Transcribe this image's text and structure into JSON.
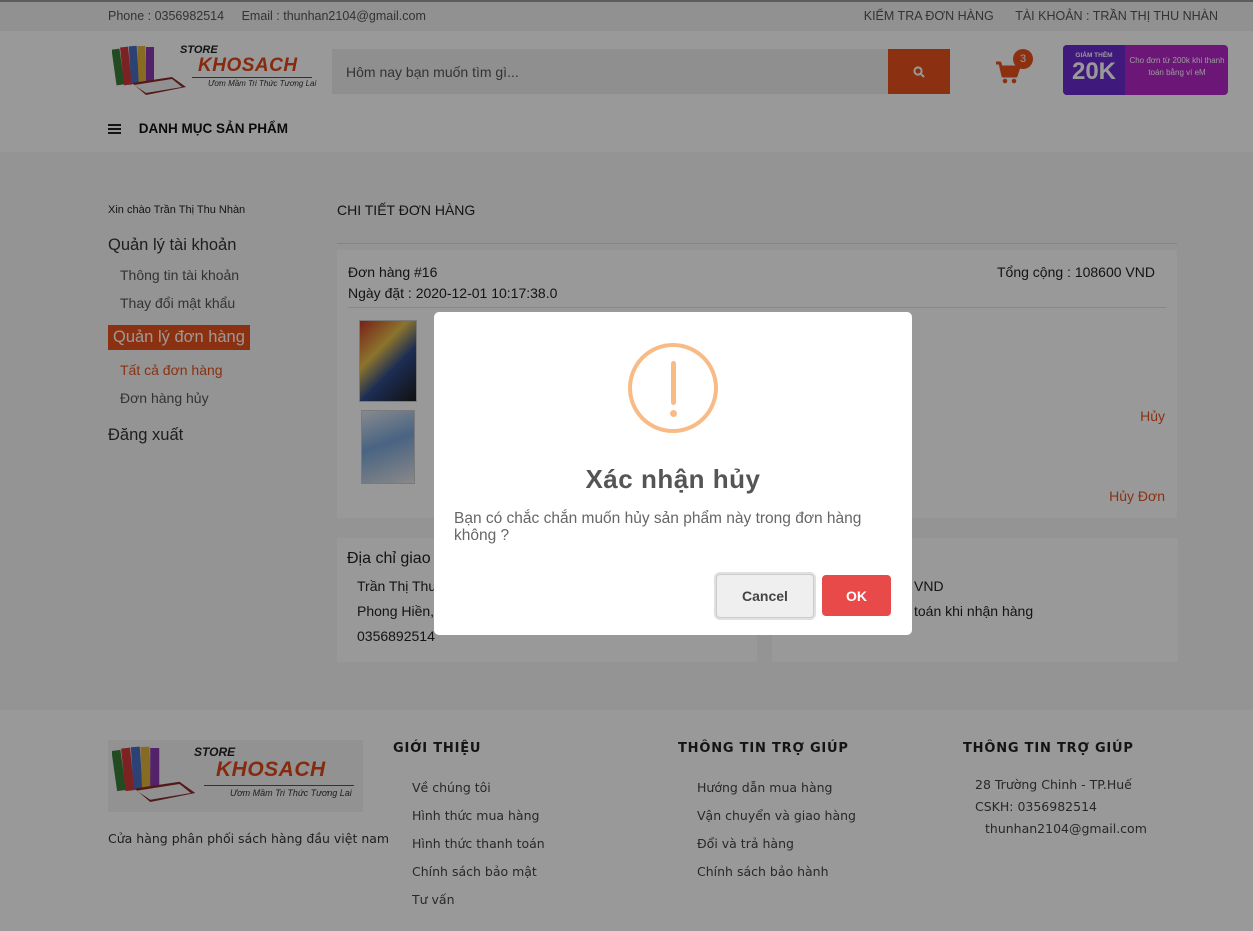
{
  "topbar": {
    "phone": "Phone : 0356982514",
    "email": "Email : thunhan2104@gmail.com",
    "check_order": "KIỂM TRA ĐƠN HÀNG",
    "account": "TÀI KHOẢN : TRẦN THỊ THU NHÀN"
  },
  "logo": {
    "store": "STORE",
    "brand": "KHOSACH",
    "slogan": "Ươm Mầm Tri Thức Tương Lai"
  },
  "search": {
    "placeholder": "Hôm nay bạn muốn tìm gì...",
    "icon": "search-icon"
  },
  "cart": {
    "icon": "cart-icon",
    "count": "3"
  },
  "promo": {
    "small": "GIẢM THÊM",
    "big": "20K",
    "text": "Cho đơn từ 200k khi thanh toán bằng ví eM"
  },
  "category_menu": {
    "label": "DANH MỤC SẢN PHẨM",
    "icon": "menu-icon"
  },
  "sidebar": {
    "greeting": "Xin chào Trần Thị Thu Nhàn",
    "account_section": "Quản lý tài khoản",
    "account_info": "Thông tin tài khoản",
    "change_password": "Thay đổi mật khẩu",
    "orders_section": "Quản lý đơn hàng",
    "all_orders": "Tất cả đơn hàng",
    "cancelled_orders": "Đơn hàng hủy",
    "logout": "Đăng xuất"
  },
  "content": {
    "title": "CHI TIẾT ĐƠN HÀNG",
    "order_code": "Đơn hàng #16",
    "order_date": "Ngày đặt : 2020-12-01 10:17:38.0",
    "total": "Tổng cộng : 108600 VND",
    "cancel_item": "Hủy",
    "cancel_order": "Hủy Đơn",
    "address_heading": "Địa chỉ giao",
    "address_name": "Trần Thị Thu",
    "address_place": "Phong Hiền,",
    "address_phone": "0356892514",
    "pay_amount": "VND",
    "pay_method": "toán khi nhận hàng"
  },
  "footer": {
    "desc": "Cửa hàng phân phối sách hàng đầu việt nam",
    "col1": {
      "heading": "GIỚI THIỆU",
      "items": [
        "Về chúng tôi",
        "Hình thức mua hàng",
        "Hình thức thanh toán",
        "Chính sách bảo mật",
        "Tư vấn"
      ]
    },
    "col2": {
      "heading": "THÔNG TIN TRỢ GIÚP",
      "items": [
        "Hướng dẫn mua hàng",
        "Vận chuyển và giao hàng",
        "Đổi và trả hàng",
        "Chính sách bảo hành"
      ]
    },
    "col3": {
      "heading": "THÔNG TIN TRỢ GIÚP",
      "items": [
        "28 Trường Chinh - TP.Huế",
        "CSKH: 0356982514",
        "thunhan2104@gmail.com"
      ]
    }
  },
  "modal": {
    "icon": "warning-icon",
    "title": "Xác nhận hủy",
    "text": "Bạn có chắc chắn muốn hủy sản phẩm này trong đơn hàng không ?",
    "cancel_label": "Cancel",
    "ok_label": "OK"
  },
  "colors": {
    "accent": "#e8531d",
    "ok": "#e84a4a",
    "warning": "#f8bb86"
  }
}
